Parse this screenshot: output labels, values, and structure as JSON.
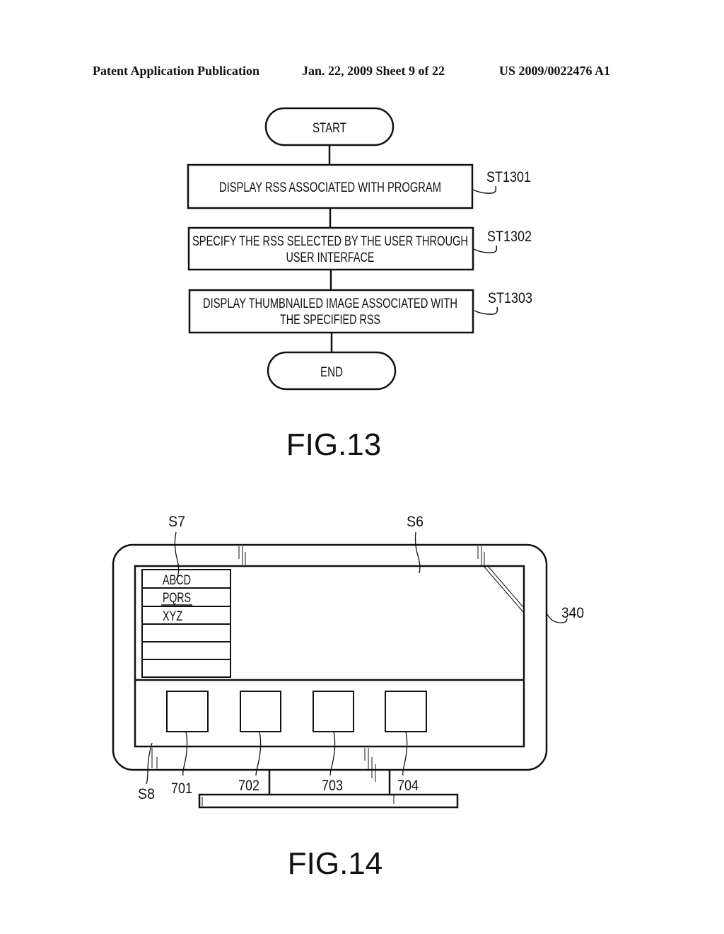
{
  "header": {
    "publication": "Patent Application Publication",
    "date_sheet": "Jan. 22, 2009  Sheet 9 of 22",
    "number": "US 2009/0022476 A1"
  },
  "fig13": {
    "caption": "FIG.13",
    "start": "START",
    "end": "END",
    "steps": [
      {
        "label": "ST1301",
        "lines": [
          "DISPLAY RSS ASSOCIATED WITH PROGRAM"
        ]
      },
      {
        "label": "ST1302",
        "lines": [
          "SPECIFY THE RSS SELECTED BY THE USER THROUGH",
          "USER INTERFACE"
        ]
      },
      {
        "label": "ST1303",
        "lines": [
          "DISPLAY THUMBNAILED IMAGE ASSOCIATED WITH",
          "THE SPECIFIED RSS"
        ]
      }
    ]
  },
  "fig14": {
    "caption": "FIG.14",
    "labels": {
      "s7": "S7",
      "s6": "S6",
      "s8": "S8",
      "device": "340",
      "thumb1": "701",
      "thumb2": "702",
      "thumb3": "703",
      "thumb4": "704"
    },
    "rss_list": [
      "ABCD",
      "PQRS",
      "XYZ",
      "",
      "",
      ""
    ]
  }
}
